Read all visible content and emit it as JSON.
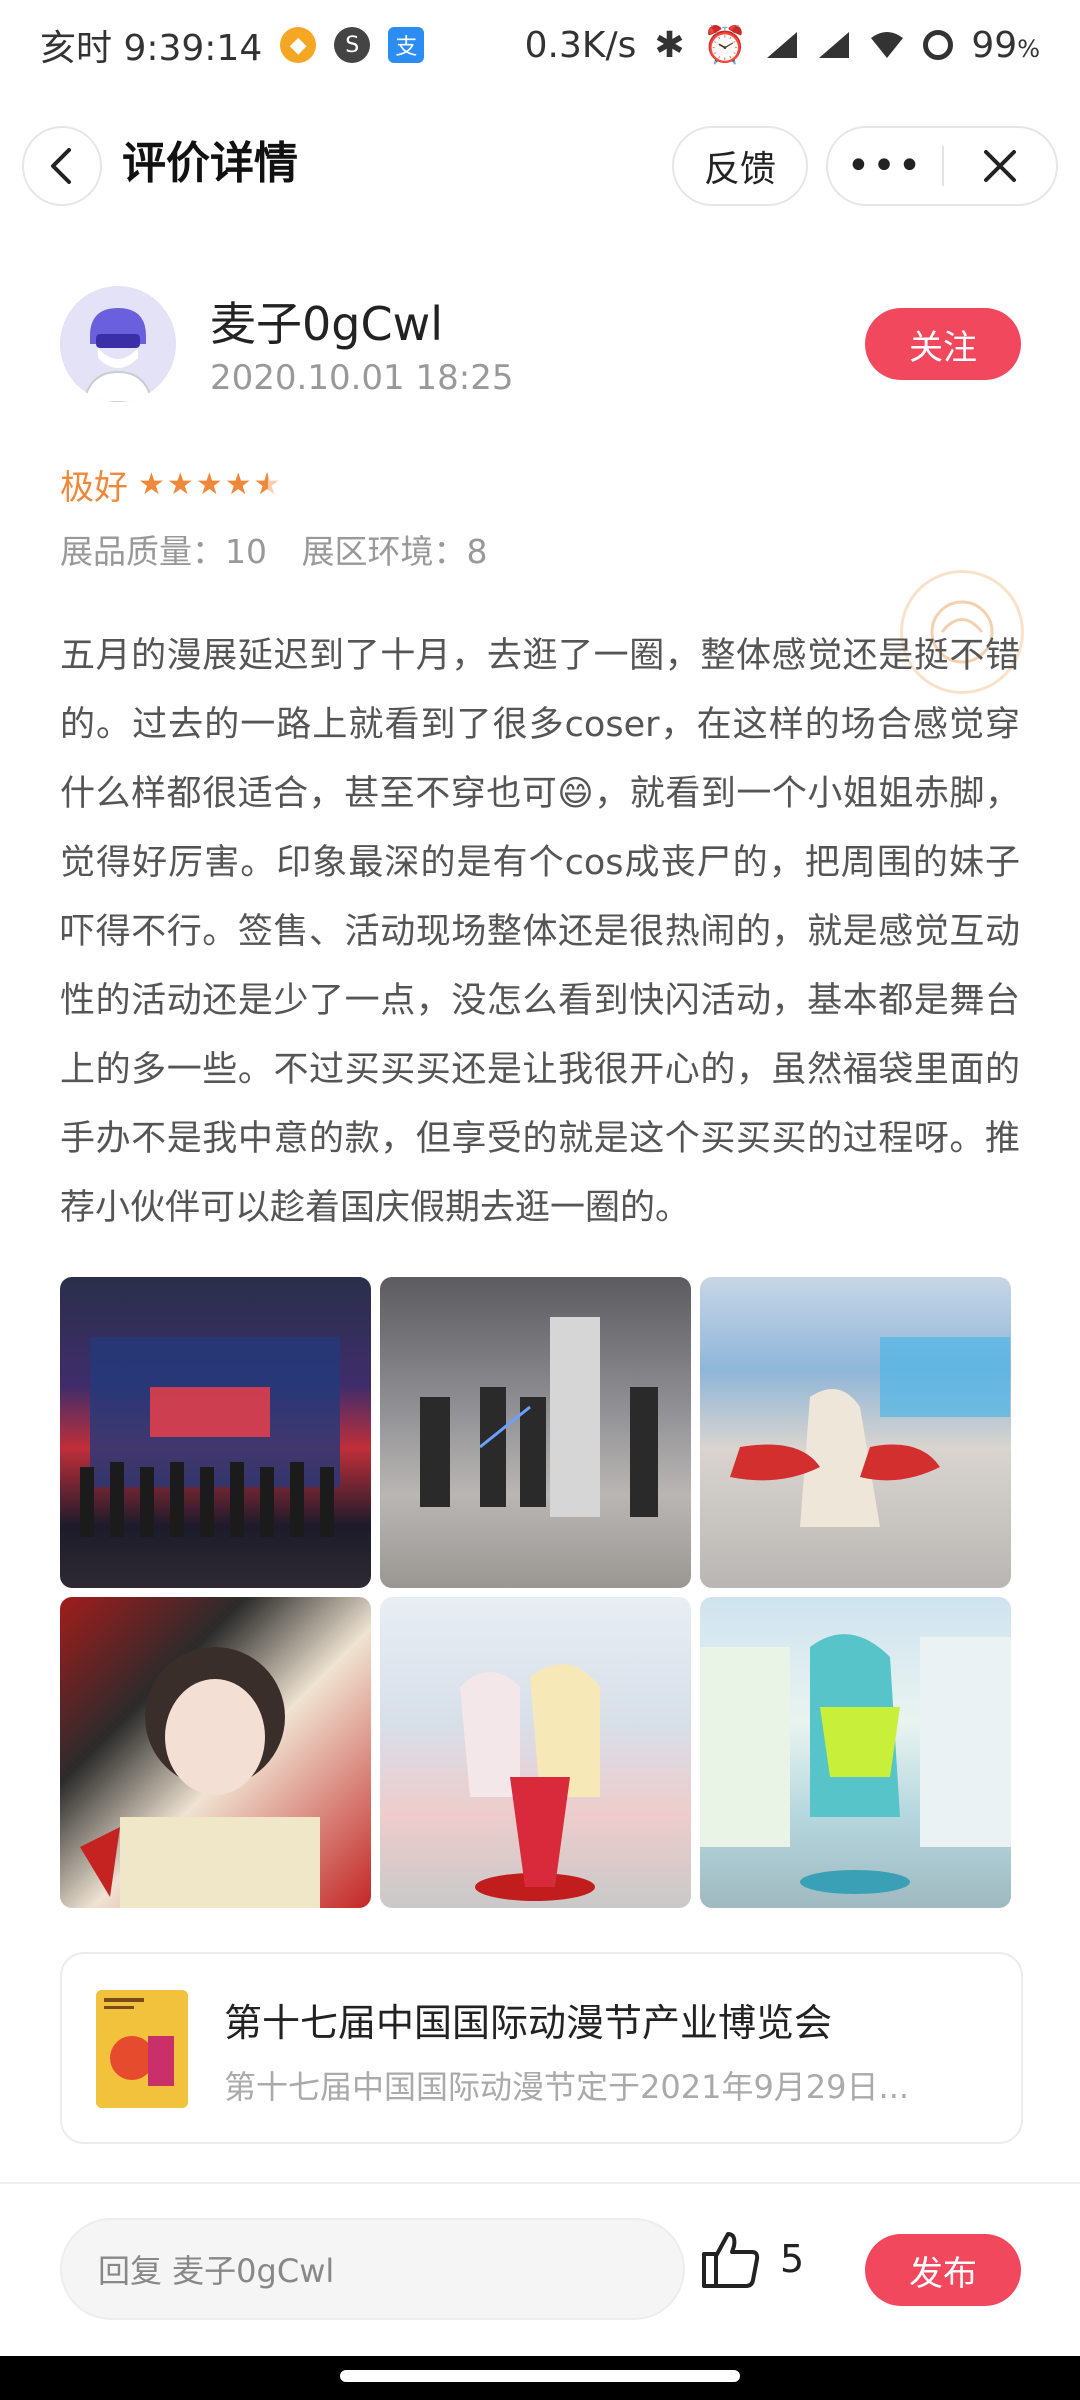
{
  "status_bar": {
    "time": "亥时 9:39:14",
    "speed": "0.3K/s",
    "battery": "99",
    "battery_unit": "%"
  },
  "header": {
    "title": "评价详情",
    "feedback_label": "反馈",
    "more_label": "•••"
  },
  "user": {
    "name": "麦子0gCwl",
    "time": "2020.10.01 18:25",
    "follow_label": "关注"
  },
  "rating": {
    "label": "极好",
    "stars": 4.5,
    "quality": "展品质量：10",
    "environment": "展区环境：8"
  },
  "review": {
    "text": "五月的漫展延迟到了十月，去逛了一圈，整体感觉还是挺不错的。过去的一路上就看到了很多coser，在这样的场合感觉穿什么样都很适合，甚至不穿也可😄，就看到一个小姐姐赤脚，觉得好厉害。印象最深的是有个cos成丧尸的，把周围的妹子吓得不行。签售、活动现场整体还是很热闹的，就是感觉互动性的活动还是少了一点，没怎么看到快闪活动，基本都是舞台上的多一些。不过买买买还是让我很开心的，虽然福袋里面的手办不是我中意的款，但享受的就是这个买买买的过程呀。推荐小伙伴可以趁着国庆假期去逛一圈的。"
  },
  "event": {
    "title": "第十七届中国国际动漫节产业博览会",
    "desc": "第十七届中国国际动漫节定于2021年9月29日..."
  },
  "bottom": {
    "reply_placeholder": "回复 麦子0gCwl",
    "like_count": "5",
    "publish_label": "发布"
  },
  "colors": {
    "accent": "#f2485e",
    "rating": "#f0883a"
  }
}
